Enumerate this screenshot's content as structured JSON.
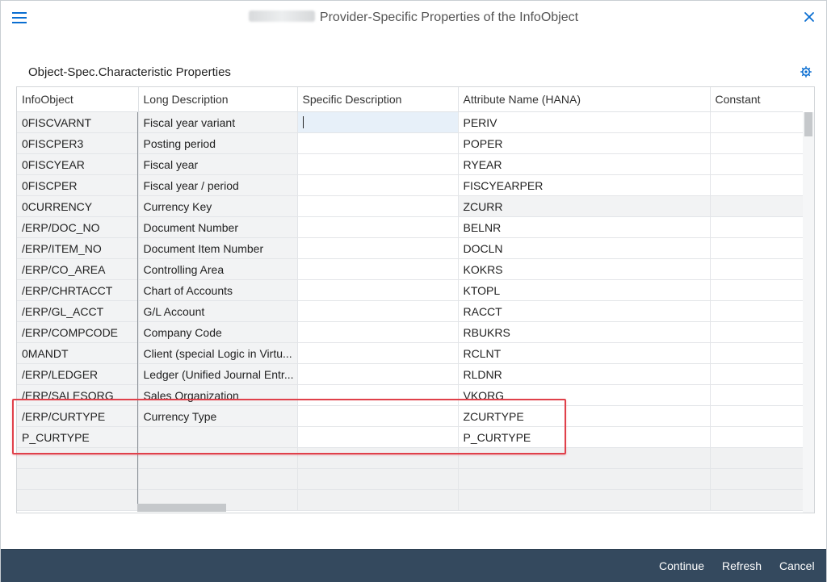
{
  "dialog": {
    "title": "Provider-Specific Properties of the InfoObject"
  },
  "section": {
    "title": "Object-Spec.Characteristic Properties"
  },
  "table": {
    "headers": [
      "InfoObject",
      "Long Description",
      "Specific Description",
      "Attribute Name (HANA)",
      "Constant"
    ],
    "rows": [
      [
        "0FISCVARNT",
        "Fiscal year variant",
        "",
        "PERIV",
        ""
      ],
      [
        "0FISCPER3",
        "Posting period",
        "",
        "POPER",
        ""
      ],
      [
        "0FISCYEAR",
        "Fiscal year",
        "",
        "RYEAR",
        ""
      ],
      [
        "0FISCPER",
        "Fiscal year / period",
        "",
        "FISCYEARPER",
        ""
      ],
      [
        "0CURRENCY",
        "Currency Key",
        "",
        "ZCURR",
        ""
      ],
      [
        "/ERP/DOC_NO",
        "Document Number",
        "",
        "BELNR",
        ""
      ],
      [
        "/ERP/ITEM_NO",
        "Document Item Number",
        "",
        "DOCLN",
        ""
      ],
      [
        "/ERP/CO_AREA",
        "Controlling Area",
        "",
        "KOKRS",
        ""
      ],
      [
        "/ERP/CHRTACCT",
        "Chart of Accounts",
        "",
        "KTOPL",
        ""
      ],
      [
        "/ERP/GL_ACCT",
        "G/L Account",
        "",
        "RACCT",
        ""
      ],
      [
        "/ERP/COMPCODE",
        "Company Code",
        "",
        "RBUKRS",
        ""
      ],
      [
        "0MANDT",
        "Client (special Logic in Virtu...",
        "",
        "RCLNT",
        ""
      ],
      [
        "/ERP/LEDGER",
        "Ledger (Unified Journal Entr...",
        "",
        "RLDNR",
        ""
      ],
      [
        "/ERP/SALESORG",
        "Sales Organization",
        "",
        "VKORG",
        ""
      ],
      [
        "/ERP/CURTYPE",
        "Currency Type",
        "",
        "ZCURTYPE",
        ""
      ],
      [
        "P_CURTYPE",
        "",
        "",
        "P_CURTYPE",
        ""
      ]
    ]
  },
  "footer": {
    "continue_label": "Continue",
    "refresh_label": "Refresh",
    "cancel_label": "Cancel"
  },
  "colors": {
    "accent": "#0a6ed1",
    "footer_bg": "#34495e",
    "highlight": "#e0404a"
  },
  "icons": {
    "menu": "menu-icon",
    "close": "close-icon",
    "settings": "settings-icon"
  }
}
